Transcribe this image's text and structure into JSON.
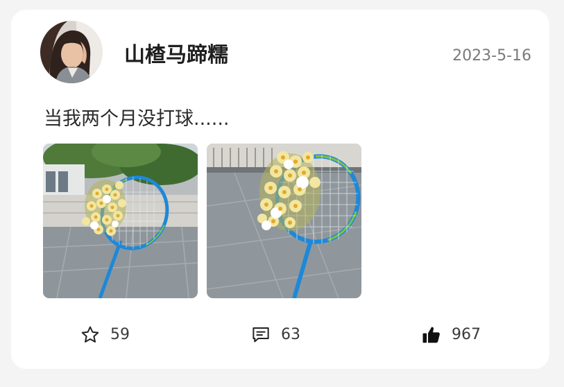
{
  "post": {
    "author": {
      "name": "山楂马蹄糯",
      "avatar_icon": "user-avatar-photo"
    },
    "date": "2023-5-16",
    "text": "当我两个月没打球......",
    "photos": [
      {
        "icon": "badminton-racket-flowers-photo"
      },
      {
        "icon": "badminton-racket-flowers-closeup-photo"
      }
    ],
    "actions": {
      "favorite": {
        "icon": "star-icon",
        "count": "59"
      },
      "comment": {
        "icon": "comment-icon",
        "count": "63"
      },
      "like": {
        "icon": "thumbs-up-icon",
        "count": "967"
      }
    }
  },
  "colors": {
    "page_background": "#f4f4f5",
    "card_background": "#ffffff",
    "text_primary": "#1f1f1f",
    "text_secondary": "#7a7a7a",
    "racket_blue": "#1e88d8",
    "racket_green": "#7cc242"
  }
}
